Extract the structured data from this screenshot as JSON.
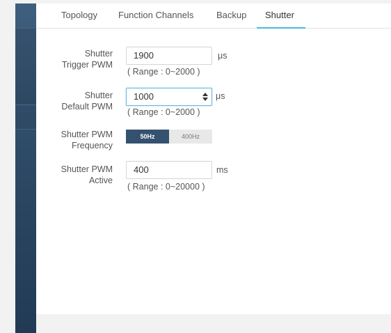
{
  "tabs": [
    {
      "label": "Topology"
    },
    {
      "label": "Function Channels"
    },
    {
      "label": "Backup"
    },
    {
      "label": "Shutter"
    }
  ],
  "active_tab": "Shutter",
  "fields": {
    "trigger_pwm": {
      "label_line1": "Shutter",
      "label_line2": "Trigger PWM",
      "value": "1900",
      "unit": "μs",
      "range": "( Range : 0~2000 )"
    },
    "default_pwm": {
      "label_line1": "Shutter",
      "label_line2": "Default PWM",
      "value": "1000",
      "unit": "μs",
      "range": "( Range : 0~2000 )"
    },
    "pwm_frequency": {
      "label_line1": "Shutter PWM",
      "label_line2": "Frequency",
      "options": [
        "50Hz",
        "400Hz"
      ],
      "selected": "50Hz"
    },
    "pwm_active": {
      "label_line1": "Shutter PWM",
      "label_line2": "Active",
      "value": "400",
      "unit": "ms",
      "range": "( Range : 0~20000 )"
    }
  },
  "colors": {
    "sidebar": "#2e4a66",
    "tab_underline": "#4fb8d8",
    "segment_on": "#34526f",
    "segment_off": "#e8e8e8"
  }
}
